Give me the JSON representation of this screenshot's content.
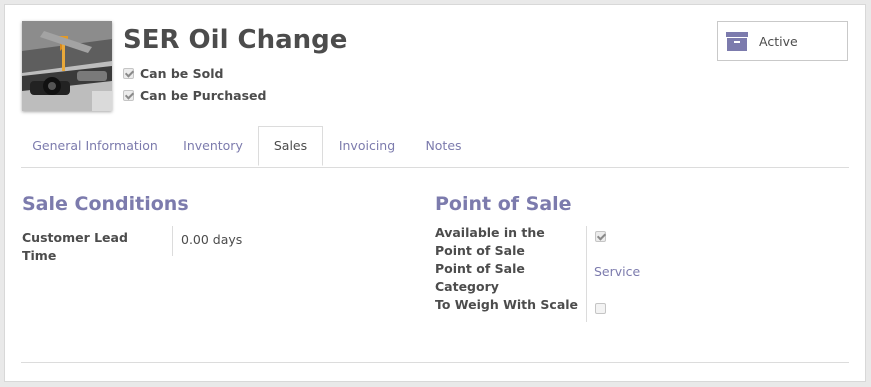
{
  "product": {
    "name": "SER Oil Change",
    "flags": [
      {
        "label": "Can be Sold",
        "checked": true
      },
      {
        "label": "Can be Purchased",
        "checked": true
      }
    ],
    "image_icon": "oil-change-photo"
  },
  "status_button": {
    "label": "Active",
    "icon": "archive-icon",
    "icon_color": "#7c7bad"
  },
  "tabs": [
    {
      "label": "General Information",
      "active": false
    },
    {
      "label": "Inventory",
      "active": false
    },
    {
      "label": "Sales",
      "active": true
    },
    {
      "label": "Invoicing",
      "active": false
    },
    {
      "label": "Notes",
      "active": false
    }
  ],
  "sale_conditions": {
    "title": "Sale Conditions",
    "customer_lead_time": {
      "label": "Customer Lead Time",
      "value": "0.00 days"
    }
  },
  "point_of_sale": {
    "title": "Point of Sale",
    "available": {
      "label": "Available in the Point of Sale",
      "checked": true
    },
    "category": {
      "label": "Point of Sale Category",
      "value": "Service"
    },
    "weigh_with_scale": {
      "label": "To Weigh With Scale",
      "checked": false
    }
  },
  "colors": {
    "accent": "#7c7bad",
    "text": "#4c4c4c",
    "border": "#dcdcdc"
  }
}
